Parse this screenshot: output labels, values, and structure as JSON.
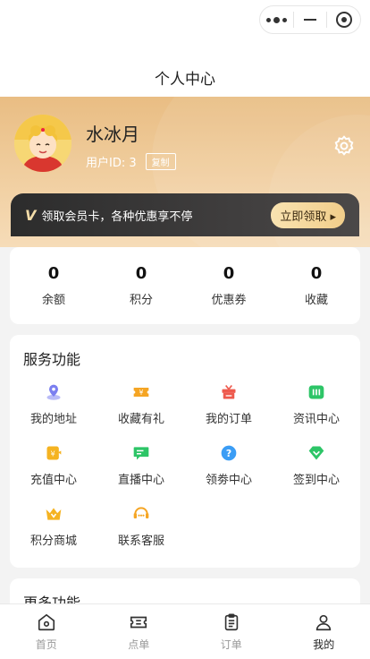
{
  "nav": {
    "title": "个人中心"
  },
  "user": {
    "name": "水冰月",
    "id_text": "用户ID: 3",
    "copy_label": "复制"
  },
  "vip": {
    "badge": "V",
    "text": "领取会员卡，各种优惠享不停",
    "button": "立即领取 ▸"
  },
  "stats": [
    {
      "value": "0",
      "label": "余额"
    },
    {
      "value": "0",
      "label": "积分"
    },
    {
      "value": "0",
      "label": "优惠券"
    },
    {
      "value": "0",
      "label": "收藏"
    }
  ],
  "services": {
    "title": "服务功能",
    "items": [
      {
        "label": "我的地址",
        "icon": "location-icon",
        "color": "#7b7ff0"
      },
      {
        "label": "收藏有礼",
        "icon": "coupon-icon",
        "color": "#f5a524"
      },
      {
        "label": "我的订单",
        "icon": "gift-icon",
        "color": "#ee5a4d"
      },
      {
        "label": "资讯中心",
        "icon": "news-icon",
        "color": "#2dc567"
      },
      {
        "label": "充值中心",
        "icon": "recharge-icon",
        "color": "#f5b321"
      },
      {
        "label": "直播中心",
        "icon": "live-icon",
        "color": "#2dc567"
      },
      {
        "label": "领劵中心",
        "icon": "help-icon",
        "color": "#3b9df5"
      },
      {
        "label": "签到中心",
        "icon": "signin-icon",
        "color": "#2dc567"
      },
      {
        "label": "积分商城",
        "icon": "crown-icon",
        "color": "#f5b321"
      },
      {
        "label": "联系客服",
        "icon": "service-icon",
        "color": "#f5a524"
      }
    ]
  },
  "more": {
    "title": "更多功能"
  },
  "tabs": [
    {
      "label": "首页",
      "icon": "home-icon",
      "active": false
    },
    {
      "label": "点单",
      "icon": "ticket-icon",
      "active": false
    },
    {
      "label": "订单",
      "icon": "clipboard-icon",
      "active": false
    },
    {
      "label": "我的",
      "icon": "user-icon",
      "active": true
    }
  ]
}
